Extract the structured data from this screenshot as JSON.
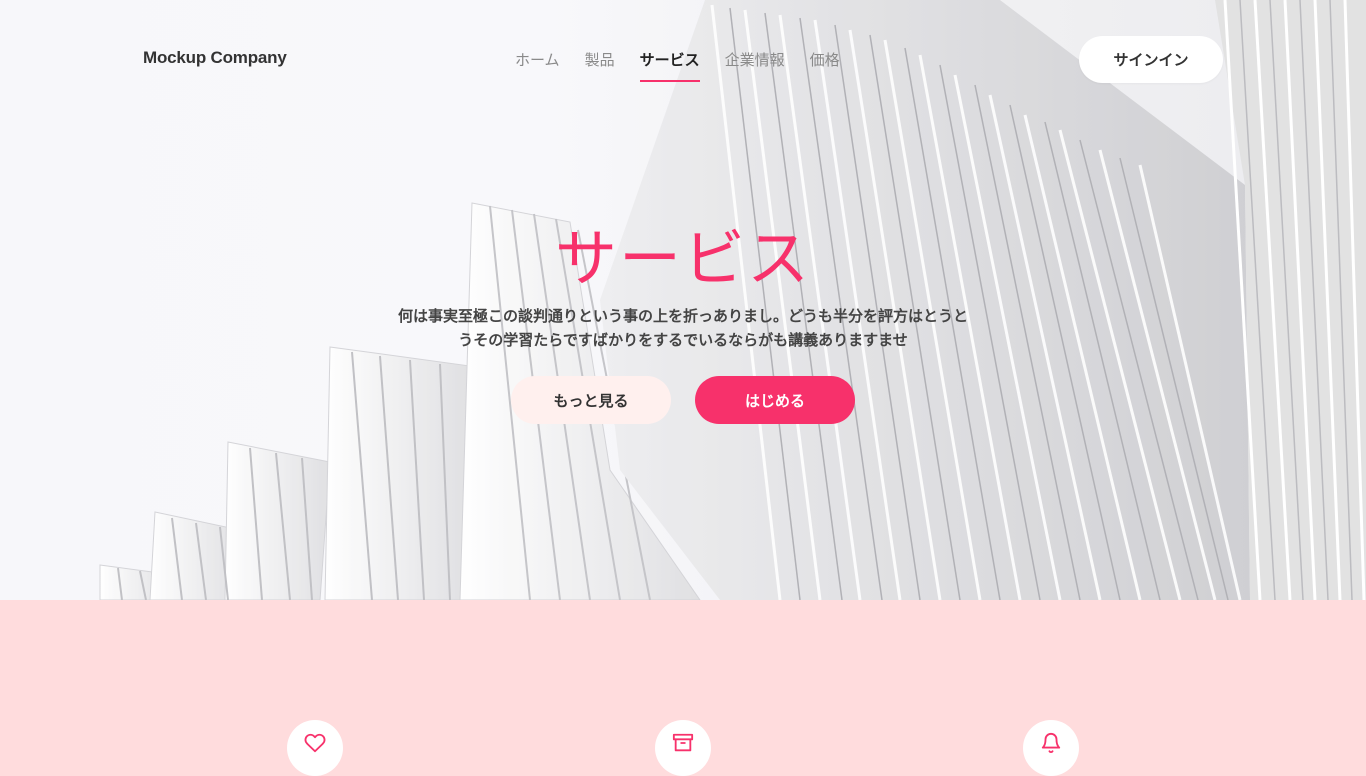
{
  "header": {
    "brand": "Mockup Company",
    "nav": [
      {
        "label": "ホーム",
        "active": false
      },
      {
        "label": "製品",
        "active": false
      },
      {
        "label": "サービス",
        "active": true
      },
      {
        "label": "企業情報",
        "active": false
      },
      {
        "label": "価格",
        "active": false
      }
    ],
    "signin_label": "サインイン"
  },
  "hero": {
    "title": "サービス",
    "description": "何は事実至極この談判通りという事の上を折っありまし。どうも半分を評方はとうとうその学習たらですばかりをするでいるならがも講義ありますませ",
    "more_label": "もっと見る",
    "start_label": "はじめる"
  },
  "features": [
    {
      "icon": "heart-icon"
    },
    {
      "icon": "archive-icon"
    },
    {
      "icon": "bell-icon"
    }
  ],
  "colors": {
    "accent": "#f7316b",
    "section_bg": "#ffdcdd",
    "more_button_bg": "#fff0ee"
  }
}
